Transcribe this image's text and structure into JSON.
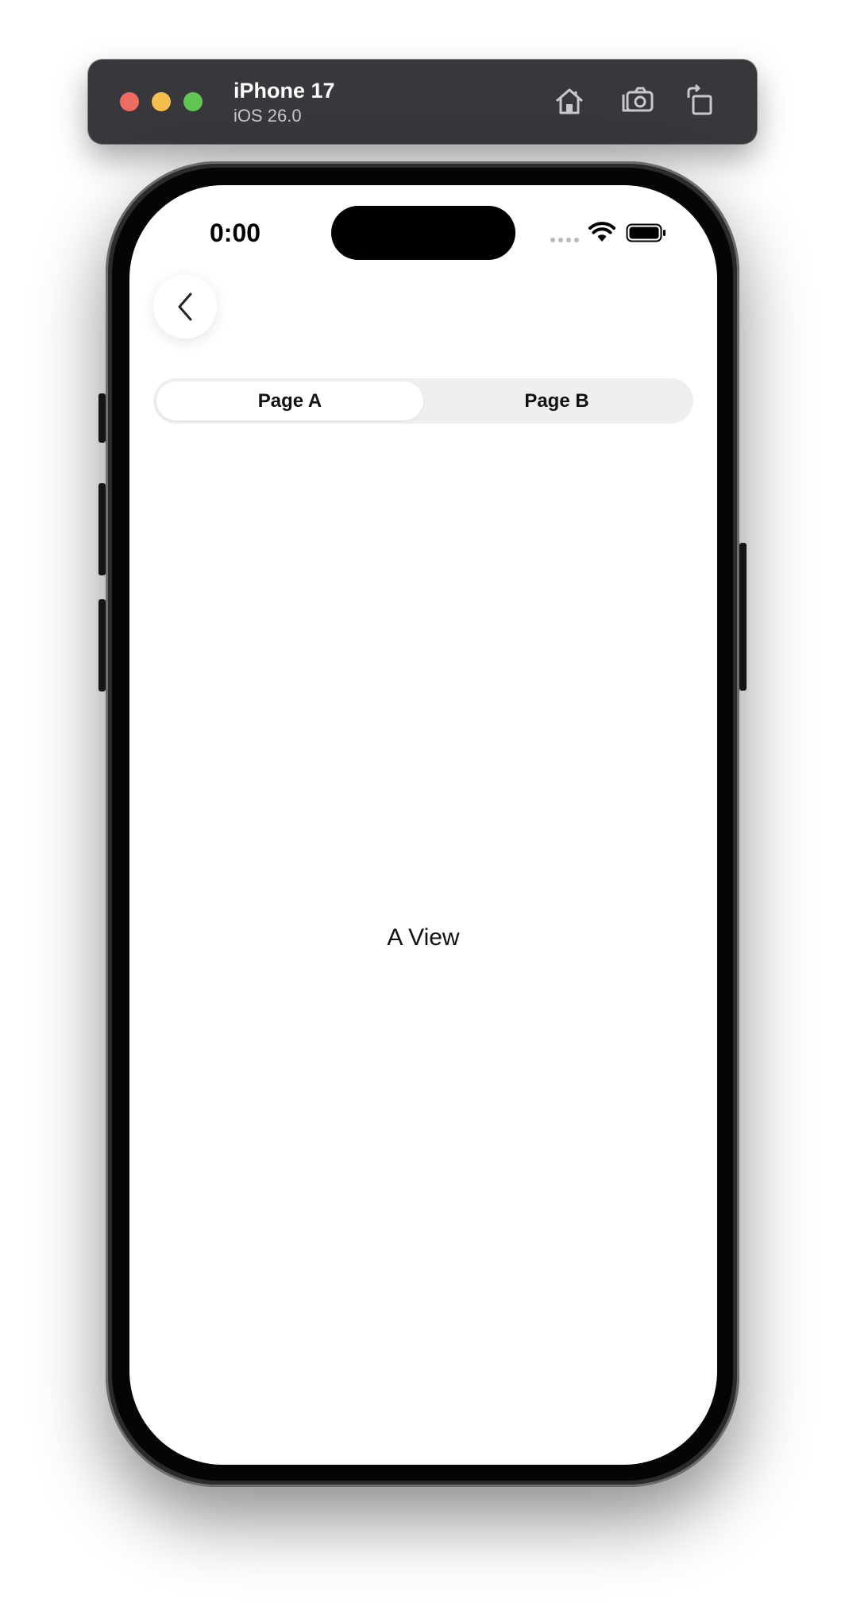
{
  "simulator": {
    "device_name": "iPhone 17",
    "os_version": "iOS 26.0",
    "toolbar_icons": [
      "home-icon",
      "screenshot-icon",
      "rotate-icon"
    ]
  },
  "status_bar": {
    "time": "0:00",
    "icons": [
      "cellular-signal-icon",
      "wifi-icon",
      "battery-icon"
    ]
  },
  "nav": {
    "back_icon": "chevron-left-icon"
  },
  "segmented_control": {
    "segments": [
      {
        "label": "Page A",
        "selected": true
      },
      {
        "label": "Page B",
        "selected": false
      }
    ]
  },
  "content": {
    "label": "A View"
  },
  "colors": {
    "toolbar_bg": "#38373c",
    "close": "#ee6b60",
    "minimize": "#f5bf4f",
    "maximize": "#61c554",
    "segment_bg": "#efefef",
    "screen_bg": "#ffffff"
  }
}
